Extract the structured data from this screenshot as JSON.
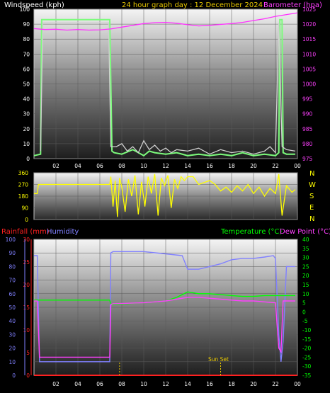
{
  "header": {
    "windspeed_label": "Windspeed (kph)",
    "graph_title": "24 hour graph day : 12 December 2024",
    "barometer_label": "Barometer (hpa)"
  },
  "bottom_header": {
    "rainfall_label": "Rainfall (mm)",
    "humidity_label": "Humidity",
    "temperature_label": "Temperature (°C)",
    "dewpoint_label": "Dew Point (°C)"
  },
  "sunset_label": "Sun Set",
  "compass": [
    "N",
    "W",
    "S",
    "E",
    "N"
  ],
  "colors": {
    "windspeed": "#7CFC7C",
    "gust": "#D0D0D0",
    "barometer": "#FF30FF",
    "direction": "#FFFF00",
    "rainfall": "#FF2020",
    "humidity": "#8080FF",
    "temperature": "#00FF00",
    "dewpoint": "#FF40FF",
    "text_white": "#FFFFFF",
    "text_gold": "#E8C800",
    "text_pink": "#FF40FF"
  },
  "chart_data": [
    {
      "type": "line",
      "x_ticks": [
        "02",
        "04",
        "06",
        "08",
        "10",
        "12",
        "14",
        "16",
        "18",
        "20",
        "22",
        "00"
      ],
      "left_axis": {
        "label": "Windspeed (kph)",
        "ticks": [
          0,
          10,
          20,
          30,
          40,
          50,
          60,
          70,
          80,
          90,
          100
        ],
        "range": [
          0,
          100
        ]
      },
      "right_axis": {
        "label": "Barometer (hpa)",
        "ticks": [
          975,
          980,
          985,
          990,
          995,
          1000,
          1005,
          1010,
          1015,
          1020,
          1025
        ],
        "range": [
          975,
          1025
        ]
      },
      "series": [
        {
          "name": "Windspeed",
          "color": "#7CFC7C",
          "axis": "left",
          "x": [
            0,
            0.6,
            0.7,
            0.9,
            1.0,
            6.8,
            6.9,
            7.1,
            7.3,
            8,
            9,
            10,
            10.5,
            11,
            12,
            13,
            14,
            15,
            16,
            17,
            18,
            19,
            20,
            21,
            22,
            22.3,
            22.4,
            22.6,
            22.7,
            23,
            23.8
          ],
          "y": [
            2,
            3,
            93,
            93,
            93,
            93,
            93,
            5,
            4,
            3,
            6,
            2,
            5,
            4,
            3,
            4,
            2,
            3,
            2,
            3,
            2,
            4,
            2,
            3,
            2,
            4,
            93,
            93,
            4,
            3,
            3
          ]
        },
        {
          "name": "Gust",
          "color": "#D0D0D0",
          "axis": "left",
          "x": [
            0.6,
            0.8,
            6.8,
            7.0,
            7.5,
            8,
            8.5,
            9,
            9.5,
            10,
            10.5,
            11,
            11.5,
            12,
            12.5,
            13,
            14,
            15,
            16,
            17,
            18,
            19,
            20,
            21,
            21.5,
            22,
            22.3,
            22.6,
            23,
            23.8
          ],
          "y": [
            5,
            91,
            91,
            8,
            8,
            10,
            5,
            8,
            4,
            12,
            6,
            9,
            5,
            7,
            4,
            6,
            5,
            7,
            3,
            6,
            4,
            5,
            3,
            5,
            8,
            4,
            91,
            8,
            6,
            5
          ]
        },
        {
          "name": "Barometer",
          "color": "#FF30FF",
          "axis": "right",
          "x": [
            0,
            1,
            2,
            3,
            4,
            5,
            6,
            7,
            8,
            9,
            10,
            11,
            12,
            13,
            14,
            15,
            16,
            17,
            18,
            19,
            20,
            21,
            22,
            23,
            24
          ],
          "y": [
            1018.5,
            1018.2,
            1018.3,
            1018.0,
            1018.2,
            1018.0,
            1018.1,
            1018.4,
            1019.0,
            1019.6,
            1020.2,
            1020.5,
            1020.6,
            1020.3,
            1019.8,
            1019.4,
            1019.6,
            1019.9,
            1020.2,
            1020.6,
            1021.2,
            1021.8,
            1022.6,
            1023.2,
            1023.8
          ]
        }
      ]
    },
    {
      "type": "line",
      "x_ticks": [
        "02",
        "04",
        "06",
        "08",
        "10",
        "12",
        "14",
        "16",
        "18",
        "20",
        "22",
        "00"
      ],
      "left_axis": {
        "ticks": [
          0,
          90,
          180,
          270,
          360
        ],
        "range": [
          0,
          360
        ]
      },
      "series": [
        {
          "name": "Wind Direction",
          "color": "#FFFF00",
          "x": [
            0,
            0.3,
            0.4,
            6.9,
            7.0,
            7.2,
            7.4,
            7.6,
            7.8,
            8.0,
            8.3,
            8.6,
            8.9,
            9.2,
            9.5,
            9.8,
            10.1,
            10.4,
            10.7,
            11,
            11.3,
            11.6,
            11.9,
            12.2,
            12.5,
            12.8,
            13.1,
            13.4,
            13.7,
            14,
            14.5,
            15,
            16,
            16.5,
            17,
            17.5,
            18,
            18.5,
            19,
            19.5,
            20,
            20.5,
            21,
            21.5,
            22,
            22.3,
            22.6,
            23,
            23.5,
            23.8
          ],
          "y": [
            200,
            200,
            270,
            270,
            330,
            100,
            300,
            20,
            320,
            250,
            60,
            310,
            180,
            340,
            40,
            290,
            100,
            330,
            200,
            350,
            30,
            320,
            260,
            340,
            90,
            310,
            240,
            330,
            300,
            330,
            330,
            270,
            300,
            270,
            220,
            250,
            210,
            260,
            220,
            270,
            200,
            250,
            180,
            240,
            200,
            350,
            30,
            260,
            210,
            230
          ]
        }
      ]
    },
    {
      "type": "line",
      "x_ticks": [
        "02",
        "04",
        "06",
        "08",
        "10",
        "12",
        "14",
        "16",
        "18",
        "20",
        "22",
        "00"
      ],
      "left_axis_rain": {
        "label": "Rainfall (mm)",
        "ticks": [
          0,
          5,
          10,
          15,
          20,
          25,
          30
        ],
        "range": [
          0,
          30
        ]
      },
      "left_axis_humidity": {
        "label": "Humidity",
        "ticks": [
          0,
          10,
          20,
          30,
          40,
          50,
          60,
          70,
          80,
          90,
          100
        ],
        "range": [
          0,
          100
        ]
      },
      "right_axis": {
        "label": "Temperature (°C)",
        "ticks": [
          -35,
          -30,
          -25,
          -20,
          -15,
          -10,
          -5,
          0,
          5,
          10,
          15,
          20,
          25,
          30,
          35,
          40
        ],
        "range": [
          -35,
          40
        ]
      },
      "series": [
        {
          "name": "Humidity",
          "color": "#8080FF",
          "axis": "humidity",
          "x": [
            0,
            0.3,
            0.5,
            0.6,
            6.8,
            6.9,
            7.0,
            7.2,
            10,
            13.5,
            14.0,
            15,
            16,
            17,
            18,
            19,
            20,
            21,
            21.8,
            22,
            22.3,
            22.5,
            22.7,
            23,
            23.8
          ],
          "y": [
            88,
            88,
            10,
            10,
            10,
            10,
            90,
            91,
            91,
            88,
            78,
            78,
            80,
            82,
            85,
            86,
            86,
            87,
            88,
            86,
            30,
            10,
            25,
            80,
            80
          ]
        },
        {
          "name": "Temperature",
          "color": "#00FF00",
          "axis": "temp",
          "x": [
            0,
            6.9,
            7.0,
            10,
            12,
            13,
            14,
            15,
            16,
            17,
            18,
            19,
            20,
            21,
            22,
            23,
            23.8
          ],
          "y": [
            6.5,
            6.5,
            4,
            5,
            6,
            8,
            11,
            10,
            10,
            9.5,
            9,
            8.5,
            8.5,
            9,
            9,
            9,
            9
          ]
        },
        {
          "name": "Dew Point",
          "color": "#FF40FF",
          "axis": "temp",
          "x": [
            0,
            0.3,
            0.5,
            0.6,
            6.8,
            6.9,
            7.0,
            7.2,
            10,
            12,
            13,
            14,
            15,
            16,
            17,
            18,
            19,
            20,
            21,
            22,
            22.3,
            22.5,
            22.7,
            23,
            23.8
          ],
          "y": [
            6,
            6,
            -25,
            -25,
            -25,
            -25,
            4,
            4.5,
            5,
            6,
            7,
            8,
            8,
            7.5,
            7,
            6.5,
            6,
            6,
            5.5,
            5,
            -20,
            -22,
            6,
            6,
            6
          ]
        },
        {
          "name": "Rainfall",
          "color": "#FF2020",
          "axis": "rain",
          "x": [
            0,
            24
          ],
          "y": [
            0,
            0
          ]
        }
      ],
      "sunset_hour": 17
    }
  ]
}
